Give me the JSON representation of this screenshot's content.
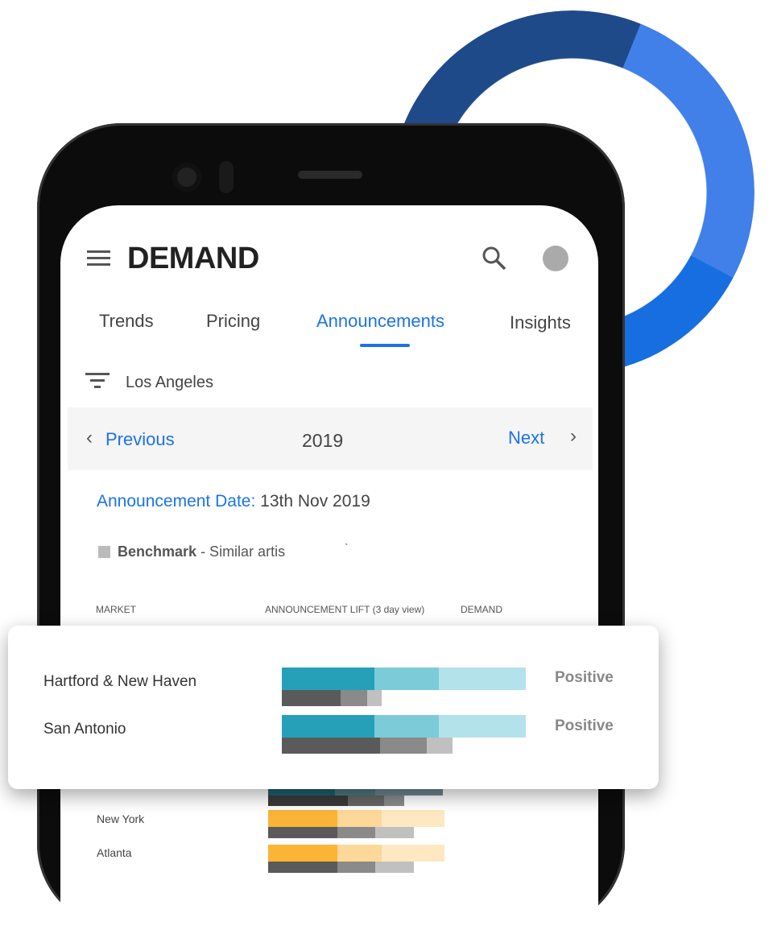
{
  "app": {
    "title": "DEMAND"
  },
  "tabs": [
    {
      "label": "Trends"
    },
    {
      "label": "Pricing"
    },
    {
      "label": "Announcements",
      "active": true
    },
    {
      "label": "Insights"
    }
  ],
  "filter": {
    "location": "Los Angeles"
  },
  "pager": {
    "previous": "Previous",
    "year": "2019",
    "next": "Next"
  },
  "announcement": {
    "label": "Announcement Date:",
    "date": "13th Nov 2019"
  },
  "legend": {
    "name": "Benchmark",
    "description": "- Similar artis",
    "stray_mark": "`"
  },
  "table": {
    "headers": [
      "MARKET",
      "ANNOUNCEMENT LIFT (3 day view)",
      "DEMAND"
    ]
  },
  "featured_rows": [
    {
      "market": "Hartford & New Haven",
      "demand": "Positive",
      "lift": [
        115,
        80,
        108
      ],
      "benchmark": [
        73,
        33,
        18
      ]
    },
    {
      "market": "San Antonio",
      "demand": "Positive",
      "lift": [
        115,
        80,
        108
      ],
      "benchmark": [
        122,
        58,
        32
      ]
    }
  ],
  "rows": [
    {
      "market": "New York",
      "lift": [
        86,
        55,
        78
      ],
      "benchmark": [
        86,
        47,
        48
      ]
    },
    {
      "market": "Atlanta",
      "lift": [
        86,
        55,
        78
      ],
      "benchmark": [
        86,
        47,
        48
      ]
    }
  ],
  "colors": {
    "accent": "#1a73e8",
    "teal": [
      "#26a0b8",
      "#7ccbd8",
      "#b4e2ea"
    ],
    "orange": [
      "#fbb436",
      "#fdd898",
      "#fee8c2"
    ],
    "grey": [
      "#5a5a5a",
      "#8a8a8a",
      "#c0c0c0"
    ],
    "donut": [
      "#1f4a8a",
      "#4180e8",
      "#176ee0"
    ]
  }
}
